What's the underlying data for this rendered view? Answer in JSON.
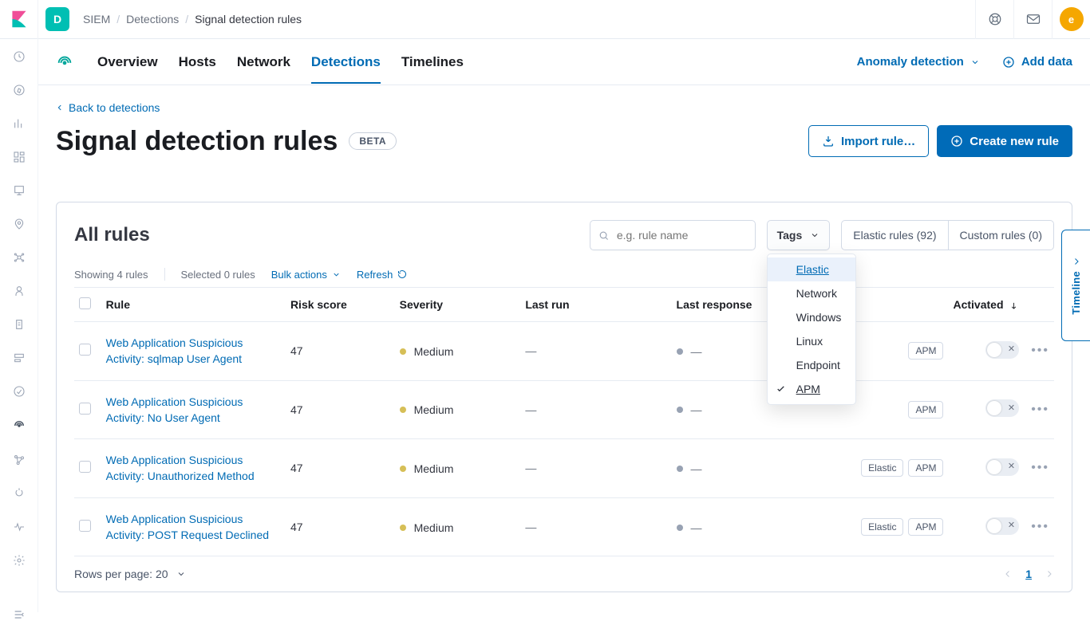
{
  "topbar": {
    "space_initial": "D",
    "breadcrumbs": [
      "SIEM",
      "Detections",
      "Signal detection rules"
    ],
    "user_initial": "e"
  },
  "subnav": {
    "tabs": [
      "Overview",
      "Hosts",
      "Network",
      "Detections",
      "Timelines"
    ],
    "active_tab": "Detections",
    "anomaly_label": "Anomaly detection",
    "add_data_label": "Add data"
  },
  "page": {
    "back_label": "Back to detections",
    "title": "Signal detection rules",
    "beta_label": "BETA",
    "import_label": "Import rule…",
    "create_label": "Create new rule"
  },
  "panel": {
    "title": "All rules",
    "search_placeholder": "e.g. rule name",
    "tags_label": "Tags",
    "segments": {
      "elastic": "Elastic rules (92)",
      "custom": "Custom rules (0)"
    },
    "showing": "Showing 4 rules",
    "selected": "Selected 0 rules",
    "bulk_label": "Bulk actions",
    "refresh_label": "Refresh",
    "headers": {
      "rule": "Rule",
      "risk": "Risk score",
      "severity": "Severity",
      "last_run": "Last run",
      "last_response": "Last response",
      "activated": "Activated"
    },
    "rows": [
      {
        "rule": "Web Application Suspicious Activity: sqlmap User Agent",
        "risk": "47",
        "severity": "Medium",
        "last_run": "—",
        "last_response": "—",
        "tags": [
          "APM"
        ],
        "activated": false
      },
      {
        "rule": "Web Application Suspicious Activity: No User Agent",
        "risk": "47",
        "severity": "Medium",
        "last_run": "—",
        "last_response": "—",
        "tags": [
          "APM"
        ],
        "activated": false
      },
      {
        "rule": "Web Application Suspicious Activity: Unauthorized Method",
        "risk": "47",
        "severity": "Medium",
        "last_run": "—",
        "last_response": "—",
        "tags": [
          "Elastic",
          "APM"
        ],
        "activated": false
      },
      {
        "rule": "Web Application Suspicious Activity: POST Request Declined",
        "risk": "47",
        "severity": "Medium",
        "last_run": "—",
        "last_response": "—",
        "tags": [
          "Elastic",
          "APM"
        ],
        "activated": false
      }
    ],
    "rows_per_page_label": "Rows per page: 20",
    "current_page": "1"
  },
  "tags_popover": {
    "items": [
      "Elastic",
      "Network",
      "Windows",
      "Linux",
      "Endpoint",
      "APM"
    ],
    "highlighted": "Elastic",
    "selected": [
      "APM"
    ]
  },
  "timeline_tab": {
    "label": "Timeline"
  }
}
